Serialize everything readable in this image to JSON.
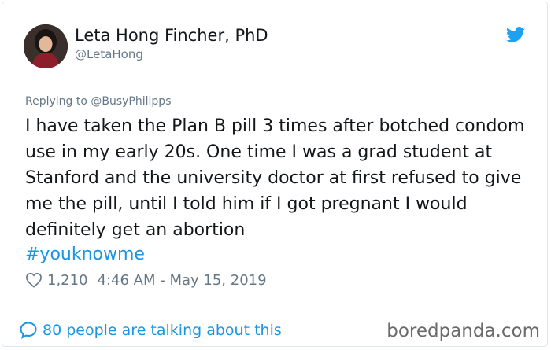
{
  "author": {
    "name": "Leta Hong Fincher, PhD",
    "handle": "@LetaHong"
  },
  "icons": {
    "platform": "twitter-bird-icon",
    "like": "heart-icon",
    "conversation": "speech-bubble-icon"
  },
  "tweet": {
    "replying_to": "Replying to @BusyPhilipps",
    "text": "I have taken the Plan B pill 3 times after botched condom use in my early 20s. One time I was a grad student at Stanford and the university doctor at first refused to give me the pill, until I told him if I got pregnant I would definitely get an abortion",
    "hashtag": "#youknowme",
    "likes": "1,210",
    "timestamp": "4:46 AM - May 15, 2019"
  },
  "footer": {
    "talking": "80 people are talking about this",
    "watermark": "boredpanda.com"
  },
  "colors": {
    "link": "#1b95e0",
    "muted": "#657786",
    "text": "#14171a",
    "border": "#e1e8ed"
  }
}
